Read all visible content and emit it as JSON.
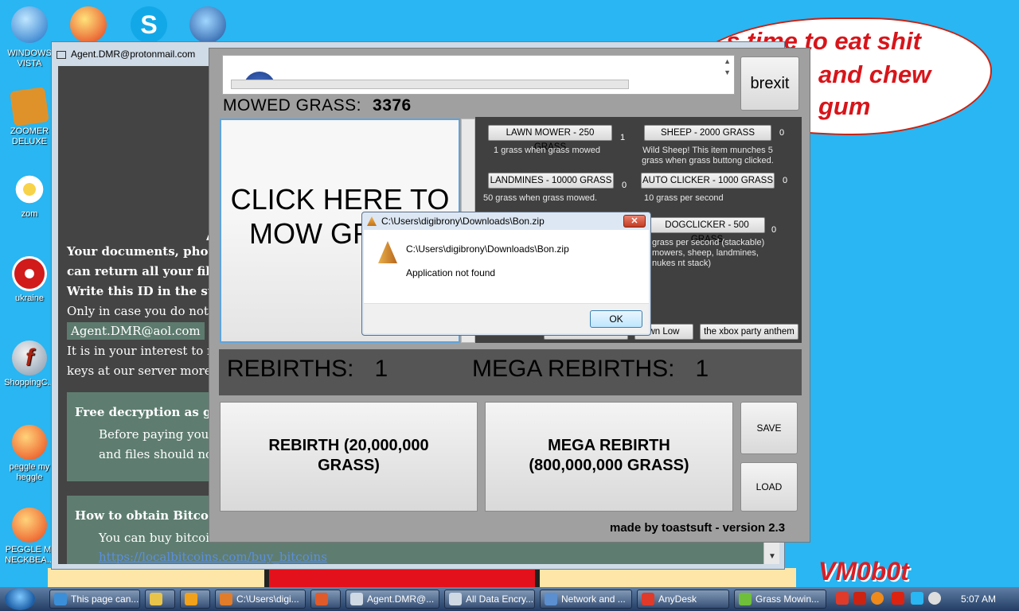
{
  "desktop": {
    "icons": [
      {
        "label": "WINDOWS VISTA",
        "color": "#3b8fd8"
      },
      {
        "label": "ZOOMER DELUXE",
        "color": "#e0922a"
      },
      {
        "label": "zom",
        "color": "#f0e4c8"
      },
      {
        "label": "ukraine",
        "color": "#d11a1a"
      },
      {
        "label": "ShoppingC...",
        "color": "#8fa9c4"
      },
      {
        "label": "peggle my heggle",
        "color": "#e8461c"
      },
      {
        "label": "PEGGLE MI NECKBEA...",
        "color": "#e8461c"
      }
    ],
    "bubble_lines": [
      "it's time to eat shit",
      "and chew",
      "gum"
    ],
    "watermark": "VM0b0t"
  },
  "ransom_window": {
    "title": "Agent.DMR@protonmail.com",
    "lines": [
      "Your documents, photos",
      "can return all your files",
      "Write this ID in the subje",
      "Only in case you do not rec",
      "It is in your interest to resp",
      "keys at our server more tha"
    ],
    "email": "Agent.DMR@aol.com",
    "big_letter": "A",
    "box1_title": "Free decryption as gua",
    "box1_lines": [
      "Before paying you ca",
      "and files should not co"
    ],
    "box2_title": "How to obtain Bitcoins",
    "box2_lines": [
      "You can buy bitcoin from here:",
      "https://localbitcoins.com/buy_bitcoins"
    ]
  },
  "game": {
    "mowed_label": "MOWED GRASS:",
    "mowed_value": "3376",
    "brexit_label": "brexit",
    "click_label": "CLICK HERE TO MOW GRASS",
    "shop": [
      {
        "label": "LAWN MOWER - 250 GRASS",
        "count": "1",
        "desc": "1 grass when grass mowed"
      },
      {
        "label": "SHEEP - 2000 GRASS",
        "count": "0",
        "desc": "Wild Sheep! This item munches 5 grass when grass buttong clicked."
      },
      {
        "label": "LANDMINES - 10000 GRASS",
        "count": "0",
        "desc": "50 grass when grass mowed."
      },
      {
        "label": "AUTO CLICKER - 1000 GRASS",
        "count": "0",
        "desc": "10 grass per second"
      },
      {
        "label": "DOGCLICKER - 500 GRASS",
        "count": "0",
        "desc": "grass per second (stackable) mowers, sheep, landmines, nukes nt stack)"
      }
    ],
    "music_buttons": [
      "wn Low",
      "the xbox party anthem"
    ],
    "rebirths_label": "REBIRTHS:",
    "rebirths_value": "1",
    "mega_rebirths_label": "MEGA REBIRTHS:",
    "mega_rebirths_value": "1",
    "rebirth_button": "REBIRTH (20,000,000 GRASS)",
    "mega_rebirth_button": "MEGA REBIRTH (800,000,000 GRASS)",
    "save_label": "SAVE",
    "load_label": "LOAD",
    "credit": "made by toastsuft - version 2.3"
  },
  "dialog": {
    "title": "C:\\Users\\digibrony\\Downloads\\Bon.zip",
    "close": "✕",
    "path": "C:\\Users\\digibrony\\Downloads\\Bon.zip",
    "message": "Application not found",
    "ok": "OK"
  },
  "taskbar": {
    "items": [
      {
        "label": "This page can...",
        "color": "#3b8fd8"
      },
      {
        "label": "",
        "color": "#e9c44a"
      },
      {
        "label": "",
        "color": "#f2a11a"
      },
      {
        "label": "C:\\Users\\digi...",
        "color": "#e07c2a"
      },
      {
        "label": "",
        "color": "#e05a2a"
      },
      {
        "label": "Agent.DMR@...",
        "color": "#cfd9e4"
      },
      {
        "label": "All Data Encry...",
        "color": "#cfd9e4"
      },
      {
        "label": "Network and ...",
        "color": "#5b8fd0"
      },
      {
        "label": "AnyDesk",
        "color": "#e03a2a"
      },
      {
        "label": "Grass Mowin...",
        "color": "#6fbf3a"
      }
    ],
    "clock": "5:07 AM"
  }
}
